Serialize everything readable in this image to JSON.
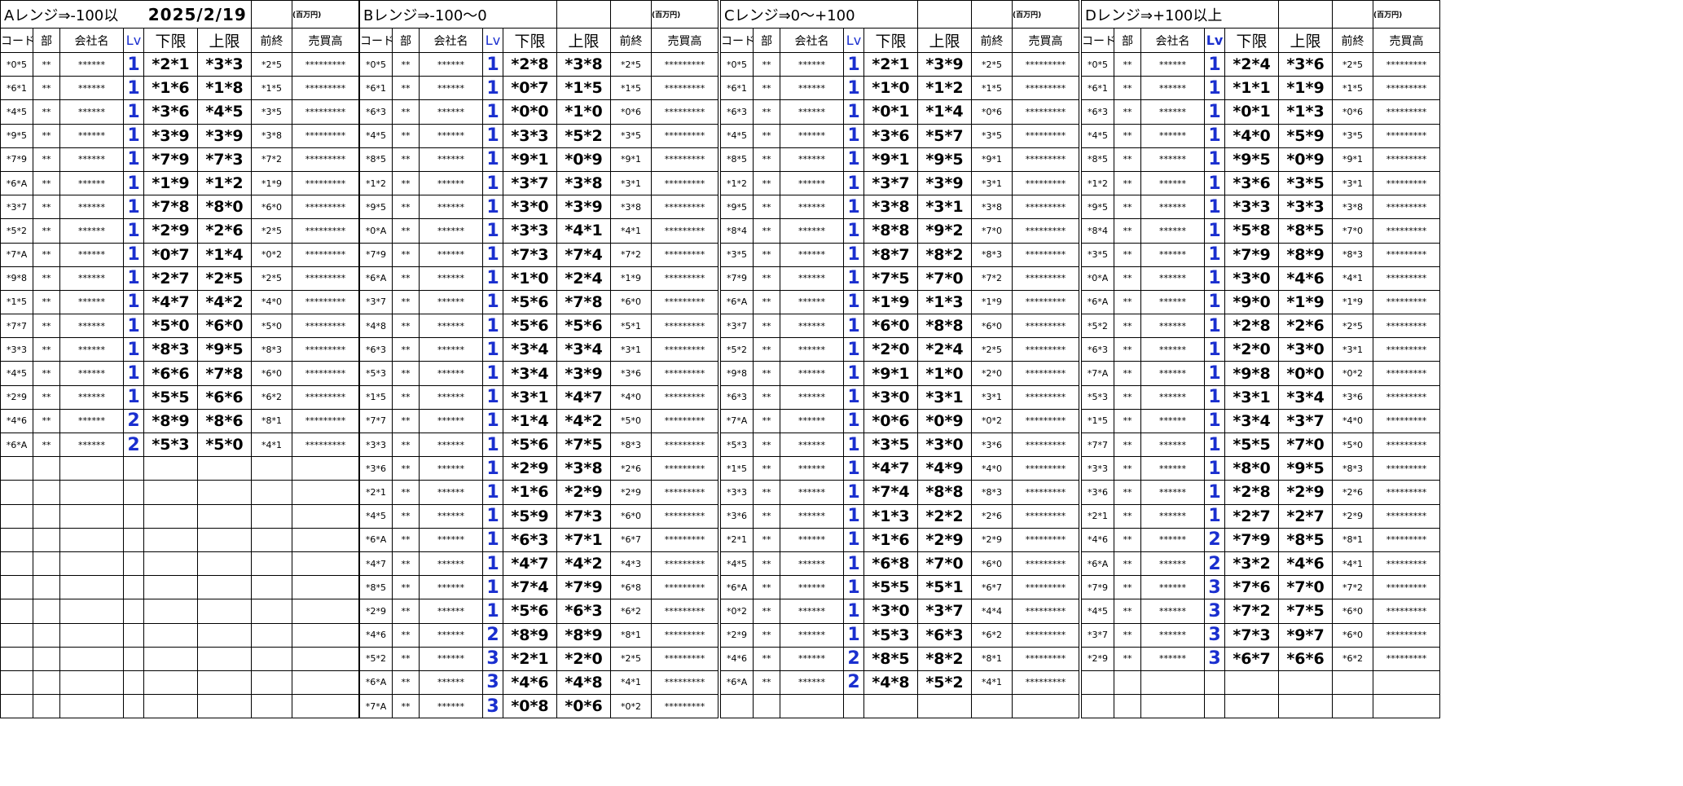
{
  "header_labels": {
    "code": "コード",
    "dept": "部",
    "company": "会社名",
    "lv": "Lv",
    "lower": "下限",
    "upper": "上限",
    "prev": "前終",
    "sales": "売買高"
  },
  "unit": "(百万円)",
  "date": "2025/2/19",
  "colors": {
    "lv": "#1a2fcf"
  },
  "blocks": [
    {
      "title": "Aレンジ⇒-100以",
      "rows": [
        [
          "*0*5",
          "**",
          "******",
          "1",
          "*2*1",
          "*3*3",
          "*2*5",
          "*********"
        ],
        [
          "*6*1",
          "**",
          "******",
          "1",
          "*1*6",
          "*1*8",
          "*1*5",
          "*********"
        ],
        [
          "*4*5",
          "**",
          "******",
          "1",
          "*3*6",
          "*4*5",
          "*3*5",
          "*********"
        ],
        [
          "*9*5",
          "**",
          "******",
          "1",
          "*3*9",
          "*3*9",
          "*3*8",
          "*********"
        ],
        [
          "*7*9",
          "**",
          "******",
          "1",
          "*7*9",
          "*7*3",
          "*7*2",
          "*********"
        ],
        [
          "*6*A",
          "**",
          "******",
          "1",
          "*1*9",
          "*1*2",
          "*1*9",
          "*********"
        ],
        [
          "*3*7",
          "**",
          "******",
          "1",
          "*7*8",
          "*8*0",
          "*6*0",
          "*********"
        ],
        [
          "*5*2",
          "**",
          "******",
          "1",
          "*2*9",
          "*2*6",
          "*2*5",
          "*********"
        ],
        [
          "*7*A",
          "**",
          "******",
          "1",
          "*0*7",
          "*1*4",
          "*0*2",
          "*********"
        ],
        [
          "*9*8",
          "**",
          "******",
          "1",
          "*2*7",
          "*2*5",
          "*2*5",
          "*********"
        ],
        [
          "*1*5",
          "**",
          "******",
          "1",
          "*4*7",
          "*4*2",
          "*4*0",
          "*********"
        ],
        [
          "*7*7",
          "**",
          "******",
          "1",
          "*5*0",
          "*6*0",
          "*5*0",
          "*********"
        ],
        [
          "*3*3",
          "**",
          "******",
          "1",
          "*8*3",
          "*9*5",
          "*8*3",
          "*********"
        ],
        [
          "*4*5",
          "**",
          "******",
          "1",
          "*6*6",
          "*7*8",
          "*6*0",
          "*********"
        ],
        [
          "*2*9",
          "**",
          "******",
          "1",
          "*5*5",
          "*6*6",
          "*6*2",
          "*********"
        ],
        [
          "*4*6",
          "**",
          "******",
          "2",
          "*8*9",
          "*8*6",
          "*8*1",
          "*********"
        ],
        [
          "*6*A",
          "**",
          "******",
          "2",
          "*5*3",
          "*5*0",
          "*4*1",
          "*********"
        ]
      ]
    },
    {
      "title": "Bレンジ⇒-100～0",
      "rows": [
        [
          "*0*5",
          "**",
          "******",
          "1",
          "*2*8",
          "*3*8",
          "*2*5",
          "*********"
        ],
        [
          "*6*1",
          "**",
          "******",
          "1",
          "*0*7",
          "*1*5",
          "*1*5",
          "*********"
        ],
        [
          "*6*3",
          "**",
          "******",
          "1",
          "*0*0",
          "*1*0",
          "*0*6",
          "*********"
        ],
        [
          "*4*5",
          "**",
          "******",
          "1",
          "*3*3",
          "*5*2",
          "*3*5",
          "*********"
        ],
        [
          "*8*5",
          "**",
          "******",
          "1",
          "*9*1",
          "*0*9",
          "*9*1",
          "*********"
        ],
        [
          "*1*2",
          "**",
          "******",
          "1",
          "*3*7",
          "*3*8",
          "*3*1",
          "*********"
        ],
        [
          "*9*5",
          "**",
          "******",
          "1",
          "*3*0",
          "*3*9",
          "*3*8",
          "*********"
        ],
        [
          "*0*A",
          "**",
          "******",
          "1",
          "*3*3",
          "*4*1",
          "*4*1",
          "*********"
        ],
        [
          "*7*9",
          "**",
          "******",
          "1",
          "*7*3",
          "*7*4",
          "*7*2",
          "*********"
        ],
        [
          "*6*A",
          "**",
          "******",
          "1",
          "*1*0",
          "*2*4",
          "*1*9",
          "*********"
        ],
        [
          "*3*7",
          "**",
          "******",
          "1",
          "*5*6",
          "*7*8",
          "*6*0",
          "*********"
        ],
        [
          "*4*8",
          "**",
          "******",
          "1",
          "*5*6",
          "*5*6",
          "*5*1",
          "*********"
        ],
        [
          "*6*3",
          "**",
          "******",
          "1",
          "*3*4",
          "*3*4",
          "*3*1",
          "*********"
        ],
        [
          "*5*3",
          "**",
          "******",
          "1",
          "*3*4",
          "*3*9",
          "*3*6",
          "*********"
        ],
        [
          "*1*5",
          "**",
          "******",
          "1",
          "*3*1",
          "*4*7",
          "*4*0",
          "*********"
        ],
        [
          "*7*7",
          "**",
          "******",
          "1",
          "*1*4",
          "*4*2",
          "*5*0",
          "*********"
        ],
        [
          "*3*3",
          "**",
          "******",
          "1",
          "*5*6",
          "*7*5",
          "*8*3",
          "*********"
        ],
        [
          "*3*6",
          "**",
          "******",
          "1",
          "*2*9",
          "*3*8",
          "*2*6",
          "*********"
        ],
        [
          "*2*1",
          "**",
          "******",
          "1",
          "*1*6",
          "*2*9",
          "*2*9",
          "*********"
        ],
        [
          "*4*5",
          "**",
          "******",
          "1",
          "*5*9",
          "*7*3",
          "*6*0",
          "*********"
        ],
        [
          "*6*A",
          "**",
          "******",
          "1",
          "*6*3",
          "*7*1",
          "*6*7",
          "*********"
        ],
        [
          "*4*7",
          "**",
          "******",
          "1",
          "*4*7",
          "*4*2",
          "*4*3",
          "*********"
        ],
        [
          "*8*5",
          "**",
          "******",
          "1",
          "*7*4",
          "*7*9",
          "*6*8",
          "*********"
        ],
        [
          "*2*9",
          "**",
          "******",
          "1",
          "*5*6",
          "*6*3",
          "*6*2",
          "*********"
        ],
        [
          "*4*6",
          "**",
          "******",
          "2",
          "*8*9",
          "*8*9",
          "*8*1",
          "*********"
        ],
        [
          "*5*2",
          "**",
          "******",
          "3",
          "*2*1",
          "*2*0",
          "*2*5",
          "*********"
        ],
        [
          "*6*A",
          "**",
          "******",
          "3",
          "*4*6",
          "*4*8",
          "*4*1",
          "*********"
        ],
        [
          "*7*A",
          "**",
          "******",
          "3",
          "*0*8",
          "*0*6",
          "*0*2",
          "*********"
        ]
      ]
    },
    {
      "title": "Cレンジ⇒0～+100",
      "rows": [
        [
          "*0*5",
          "**",
          "******",
          "1",
          "*2*1",
          "*3*9",
          "*2*5",
          "*********"
        ],
        [
          "*6*1",
          "**",
          "******",
          "1",
          "*1*0",
          "*1*2",
          "*1*5",
          "*********"
        ],
        [
          "*6*3",
          "**",
          "******",
          "1",
          "*0*1",
          "*1*4",
          "*0*6",
          "*********"
        ],
        [
          "*4*5",
          "**",
          "******",
          "1",
          "*3*6",
          "*5*7",
          "*3*5",
          "*********"
        ],
        [
          "*8*5",
          "**",
          "******",
          "1",
          "*9*1",
          "*9*5",
          "*9*1",
          "*********"
        ],
        [
          "*1*2",
          "**",
          "******",
          "1",
          "*3*7",
          "*3*9",
          "*3*1",
          "*********"
        ],
        [
          "*9*5",
          "**",
          "******",
          "1",
          "*3*8",
          "*3*1",
          "*3*8",
          "*********"
        ],
        [
          "*8*4",
          "**",
          "******",
          "1",
          "*8*8",
          "*9*2",
          "*7*0",
          "*********"
        ],
        [
          "*3*5",
          "**",
          "******",
          "1",
          "*8*7",
          "*8*2",
          "*8*3",
          "*********"
        ],
        [
          "*7*9",
          "**",
          "******",
          "1",
          "*7*5",
          "*7*0",
          "*7*2",
          "*********"
        ],
        [
          "*6*A",
          "**",
          "******",
          "1",
          "*1*9",
          "*1*3",
          "*1*9",
          "*********"
        ],
        [
          "*3*7",
          "**",
          "******",
          "1",
          "*6*0",
          "*8*8",
          "*6*0",
          "*********"
        ],
        [
          "*5*2",
          "**",
          "******",
          "1",
          "*2*0",
          "*2*4",
          "*2*5",
          "*********"
        ],
        [
          "*9*8",
          "**",
          "******",
          "1",
          "*9*1",
          "*1*0",
          "*2*0",
          "*********"
        ],
        [
          "*6*3",
          "**",
          "******",
          "1",
          "*3*0",
          "*3*1",
          "*3*1",
          "*********"
        ],
        [
          "*7*A",
          "**",
          "******",
          "1",
          "*0*6",
          "*0*9",
          "*0*2",
          "*********"
        ],
        [
          "*5*3",
          "**",
          "******",
          "1",
          "*3*5",
          "*3*0",
          "*3*6",
          "*********"
        ],
        [
          "*1*5",
          "**",
          "******",
          "1",
          "*4*7",
          "*4*9",
          "*4*0",
          "*********"
        ],
        [
          "*3*3",
          "**",
          "******",
          "1",
          "*7*4",
          "*8*8",
          "*8*3",
          "*********"
        ],
        [
          "*3*6",
          "**",
          "******",
          "1",
          "*1*3",
          "*2*2",
          "*2*6",
          "*********"
        ],
        [
          "*2*1",
          "**",
          "******",
          "1",
          "*1*6",
          "*2*9",
          "*2*9",
          "*********"
        ],
        [
          "*4*5",
          "**",
          "******",
          "1",
          "*6*8",
          "*7*0",
          "*6*0",
          "*********"
        ],
        [
          "*6*A",
          "**",
          "******",
          "1",
          "*5*5",
          "*5*1",
          "*6*7",
          "*********"
        ],
        [
          "*0*2",
          "**",
          "******",
          "1",
          "*3*0",
          "*3*7",
          "*4*4",
          "*********"
        ],
        [
          "*2*9",
          "**",
          "******",
          "1",
          "*5*3",
          "*6*3",
          "*6*2",
          "*********"
        ],
        [
          "*4*6",
          "**",
          "******",
          "2",
          "*8*5",
          "*8*2",
          "*8*1",
          "*********"
        ],
        [
          "*6*A",
          "**",
          "******",
          "2",
          "*4*8",
          "*5*2",
          "*4*1",
          "*********"
        ]
      ]
    },
    {
      "title": "Dレンジ⇒+100以上",
      "rows": [
        [
          "*0*5",
          "**",
          "******",
          "1",
          "*2*4",
          "*3*6",
          "*2*5",
          "*********"
        ],
        [
          "*6*1",
          "**",
          "******",
          "1",
          "*1*1",
          "*1*9",
          "*1*5",
          "*********"
        ],
        [
          "*6*3",
          "**",
          "******",
          "1",
          "*0*1",
          "*1*3",
          "*0*6",
          "*********"
        ],
        [
          "*4*5",
          "**",
          "******",
          "1",
          "*4*0",
          "*5*9",
          "*3*5",
          "*********"
        ],
        [
          "*8*5",
          "**",
          "******",
          "1",
          "*9*5",
          "*0*9",
          "*9*1",
          "*********"
        ],
        [
          "*1*2",
          "**",
          "******",
          "1",
          "*3*6",
          "*3*5",
          "*3*1",
          "*********"
        ],
        [
          "*9*5",
          "**",
          "******",
          "1",
          "*3*3",
          "*3*3",
          "*3*8",
          "*********"
        ],
        [
          "*8*4",
          "**",
          "******",
          "1",
          "*5*8",
          "*8*5",
          "*7*0",
          "*********"
        ],
        [
          "*3*5",
          "**",
          "******",
          "1",
          "*7*9",
          "*8*9",
          "*8*3",
          "*********"
        ],
        [
          "*0*A",
          "**",
          "******",
          "1",
          "*3*0",
          "*4*6",
          "*4*1",
          "*********"
        ],
        [
          "*6*A",
          "**",
          "******",
          "1",
          "*9*0",
          "*1*9",
          "*1*9",
          "*********"
        ],
        [
          "*5*2",
          "**",
          "******",
          "1",
          "*2*8",
          "*2*6",
          "*2*5",
          "*********"
        ],
        [
          "*6*3",
          "**",
          "******",
          "1",
          "*2*0",
          "*3*0",
          "*3*1",
          "*********"
        ],
        [
          "*7*A",
          "**",
          "******",
          "1",
          "*9*8",
          "*0*0",
          "*0*2",
          "*********"
        ],
        [
          "*5*3",
          "**",
          "******",
          "1",
          "*3*1",
          "*3*4",
          "*3*6",
          "*********"
        ],
        [
          "*1*5",
          "**",
          "******",
          "1",
          "*3*4",
          "*3*7",
          "*4*0",
          "*********"
        ],
        [
          "*7*7",
          "**",
          "******",
          "1",
          "*5*5",
          "*7*0",
          "*5*0",
          "*********"
        ],
        [
          "*3*3",
          "**",
          "******",
          "1",
          "*8*0",
          "*9*5",
          "*8*3",
          "*********"
        ],
        [
          "*3*6",
          "**",
          "******",
          "1",
          "*2*8",
          "*2*9",
          "*2*6",
          "*********"
        ],
        [
          "*2*1",
          "**",
          "******",
          "1",
          "*2*7",
          "*2*7",
          "*2*9",
          "*********"
        ],
        [
          "*4*6",
          "**",
          "******",
          "2",
          "*7*9",
          "*8*5",
          "*8*1",
          "*********"
        ],
        [
          "*6*A",
          "**",
          "******",
          "2",
          "*3*2",
          "*4*6",
          "*4*1",
          "*********"
        ],
        [
          "*7*9",
          "**",
          "******",
          "3",
          "*7*6",
          "*7*0",
          "*7*2",
          "*********"
        ],
        [
          "*4*5",
          "**",
          "******",
          "3",
          "*7*2",
          "*7*5",
          "*6*0",
          "*********"
        ],
        [
          "*3*7",
          "**",
          "******",
          "3",
          "*7*3",
          "*9*7",
          "*6*0",
          "*********"
        ],
        [
          "*2*9",
          "**",
          "******",
          "3",
          "*6*7",
          "*6*6",
          "*6*2",
          "*********"
        ]
      ]
    }
  ]
}
